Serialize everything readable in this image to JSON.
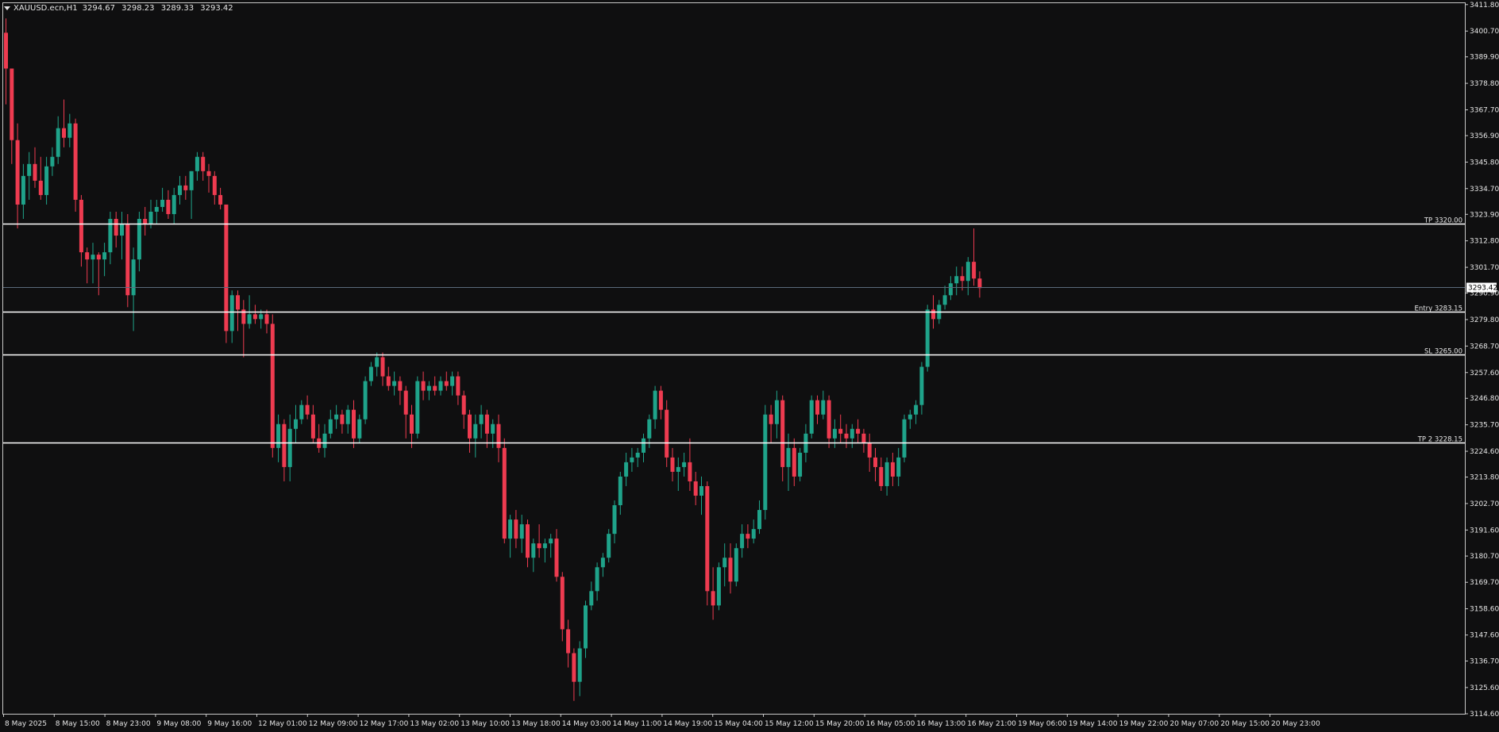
{
  "window": {
    "symbol_label": "XAUUSD.ecn,H1",
    "ohlc": [
      "3294.67",
      "3298.23",
      "3289.33",
      "3293.42"
    ]
  },
  "colors": {
    "background": "#0f0f10",
    "bull": "#1fa38a",
    "bear": "#ee3b50",
    "grid_line": "#ffffff",
    "text": "#e6e6e6",
    "price_line": "#5a6a7a"
  },
  "chart_data": {
    "type": "candlestick",
    "symbol": "XAUUSD.ecn",
    "timeframe": "H1",
    "ylim": [
      3114.6,
      3412.4
    ],
    "y_ticks": [
      "3411.80",
      "3400.70",
      "3389.90",
      "3378.80",
      "3367.70",
      "3356.90",
      "3345.80",
      "3334.70",
      "3323.90",
      "3312.80",
      "3301.70",
      "3290.90",
      "3279.80",
      "3268.70",
      "3257.60",
      "3246.80",
      "3235.70",
      "3224.60",
      "3213.80",
      "3202.70",
      "3191.60",
      "3180.70",
      "3169.70",
      "3158.60",
      "3147.60",
      "3136.70",
      "3125.60",
      "3114.60"
    ],
    "x_ticks": [
      "8 May 2025",
      "8 May 15:00",
      "8 May 23:00",
      "9 May 08:00",
      "9 May 16:00",
      "12 May 01:00",
      "12 May 09:00",
      "12 May 17:00",
      "13 May 02:00",
      "13 May 10:00",
      "13 May 18:00",
      "14 May 03:00",
      "14 May 11:00",
      "14 May 19:00",
      "15 May 04:00",
      "15 May 12:00",
      "15 May 20:00",
      "16 May 05:00",
      "16 May 13:00",
      "16 May 21:00",
      "19 May 06:00",
      "19 May 14:00",
      "19 May 22:00",
      "20 May 07:00",
      "20 May 15:00",
      "20 May 23:00"
    ],
    "current_price": "3293.42",
    "levels": [
      {
        "label": "TP 3320.00",
        "value": 3320.0
      },
      {
        "label": "Entry 3283.15",
        "value": 3283.15
      },
      {
        "label": "SL 3265.00",
        "value": 3265.0
      },
      {
        "label": "TP 2 3228.15",
        "value": 3228.15
      }
    ],
    "candles": [
      [
        3400,
        3406,
        3370,
        3385
      ],
      [
        3385,
        3380,
        3345,
        3355
      ],
      [
        3355,
        3362,
        3318,
        3328
      ],
      [
        3328,
        3345,
        3322,
        3340
      ],
      [
        3340,
        3350,
        3330,
        3345
      ],
      [
        3345,
        3352,
        3335,
        3338
      ],
      [
        3338,
        3348,
        3330,
        3332
      ],
      [
        3332,
        3348,
        3328,
        3344
      ],
      [
        3344,
        3352,
        3340,
        3348
      ],
      [
        3348,
        3365,
        3345,
        3360
      ],
      [
        3360,
        3372,
        3352,
        3356
      ],
      [
        3356,
        3366,
        3352,
        3362
      ],
      [
        3362,
        3364,
        3325,
        3330
      ],
      [
        3330,
        3332,
        3302,
        3308
      ],
      [
        3308,
        3310,
        3295,
        3305
      ],
      [
        3305,
        3312,
        3295,
        3307
      ],
      [
        3307,
        3308,
        3290,
        3305
      ],
      [
        3305,
        3312,
        3298,
        3308
      ],
      [
        3308,
        3325,
        3303,
        3322
      ],
      [
        3322,
        3325,
        3310,
        3315
      ],
      [
        3315,
        3325,
        3305,
        3320
      ],
      [
        3320,
        3324,
        3285,
        3290
      ],
      [
        3290,
        3310,
        3275,
        3305
      ],
      [
        3305,
        3325,
        3300,
        3322
      ],
      [
        3322,
        3327,
        3315,
        3320
      ],
      [
        3320,
        3330,
        3318,
        3325
      ],
      [
        3325,
        3330,
        3320,
        3327
      ],
      [
        3327,
        3335,
        3325,
        3330
      ],
      [
        3330,
        3334,
        3322,
        3324
      ],
      [
        3324,
        3335,
        3320,
        3332
      ],
      [
        3332,
        3340,
        3328,
        3336
      ],
      [
        3336,
        3340,
        3330,
        3334
      ],
      [
        3334,
        3342,
        3322,
        3342
      ],
      [
        3342,
        3350,
        3338,
        3348
      ],
      [
        3348,
        3350,
        3338,
        3342
      ],
      [
        3342,
        3345,
        3333,
        3340
      ],
      [
        3340,
        3342,
        3328,
        3332
      ],
      [
        3332,
        3335,
        3326,
        3328
      ],
      [
        3328,
        3318,
        3270,
        3275
      ],
      [
        3275,
        3292,
        3270,
        3290
      ],
      [
        3290,
        3292,
        3275,
        3284
      ],
      [
        3284,
        3288,
        3264,
        3278
      ],
      [
        3278,
        3290,
        3276,
        3282
      ],
      [
        3282,
        3286,
        3278,
        3280
      ],
      [
        3280,
        3284,
        3276,
        3282
      ],
      [
        3282,
        3284,
        3274,
        3278
      ],
      [
        3278,
        3282,
        3222,
        3226
      ],
      [
        3226,
        3240,
        3220,
        3236
      ],
      [
        3236,
        3238,
        3212,
        3218
      ],
      [
        3218,
        3240,
        3212,
        3234
      ],
      [
        3234,
        3244,
        3228,
        3238
      ],
      [
        3238,
        3246,
        3236,
        3244
      ],
      [
        3244,
        3248,
        3238,
        3240
      ],
      [
        3240,
        3244,
        3228,
        3230
      ],
      [
        3230,
        3236,
        3224,
        3226
      ],
      [
        3226,
        3236,
        3222,
        3232
      ],
      [
        3232,
        3242,
        3230,
        3238
      ],
      [
        3238,
        3244,
        3234,
        3240
      ],
      [
        3240,
        3242,
        3232,
        3236
      ],
      [
        3236,
        3244,
        3232,
        3242
      ],
      [
        3242,
        3246,
        3226,
        3230
      ],
      [
        3230,
        3240,
        3228,
        3238
      ],
      [
        3238,
        3256,
        3236,
        3254
      ],
      [
        3254,
        3262,
        3252,
        3260
      ],
      [
        3260,
        3266,
        3256,
        3264
      ],
      [
        3264,
        3266,
        3252,
        3256
      ],
      [
        3256,
        3260,
        3250,
        3252
      ],
      [
        3252,
        3258,
        3248,
        3254
      ],
      [
        3254,
        3256,
        3244,
        3250
      ],
      [
        3250,
        3252,
        3230,
        3240
      ],
      [
        3240,
        3244,
        3226,
        3232
      ],
      [
        3232,
        3256,
        3230,
        3254
      ],
      [
        3254,
        3258,
        3246,
        3250
      ],
      [
        3250,
        3254,
        3246,
        3252
      ],
      [
        3252,
        3256,
        3248,
        3250
      ],
      [
        3250,
        3256,
        3248,
        3254
      ],
      [
        3254,
        3258,
        3250,
        3252
      ],
      [
        3252,
        3258,
        3248,
        3256
      ],
      [
        3256,
        3258,
        3244,
        3248
      ],
      [
        3248,
        3250,
        3234,
        3240
      ],
      [
        3240,
        3242,
        3224,
        3230
      ],
      [
        3230,
        3240,
        3222,
        3236
      ],
      [
        3236,
        3244,
        3230,
        3240
      ],
      [
        3240,
        3242,
        3226,
        3232
      ],
      [
        3232,
        3238,
        3226,
        3236
      ],
      [
        3236,
        3240,
        3220,
        3226
      ],
      [
        3226,
        3230,
        3186,
        3188
      ],
      [
        3188,
        3198,
        3180,
        3196
      ],
      [
        3196,
        3200,
        3184,
        3188
      ],
      [
        3188,
        3198,
        3182,
        3194
      ],
      [
        3194,
        3196,
        3176,
        3180
      ],
      [
        3180,
        3188,
        3174,
        3186
      ],
      [
        3186,
        3194,
        3180,
        3184
      ],
      [
        3184,
        3188,
        3178,
        3186
      ],
      [
        3186,
        3190,
        3180,
        3188
      ],
      [
        3188,
        3192,
        3170,
        3172
      ],
      [
        3172,
        3174,
        3145,
        3150
      ],
      [
        3150,
        3154,
        3134,
        3140
      ],
      [
        3140,
        3142,
        3120,
        3128
      ],
      [
        3128,
        3145,
        3122,
        3142
      ],
      [
        3142,
        3162,
        3138,
        3160
      ],
      [
        3160,
        3170,
        3158,
        3166
      ],
      [
        3166,
        3178,
        3162,
        3176
      ],
      [
        3176,
        3182,
        3172,
        3180
      ],
      [
        3180,
        3192,
        3178,
        3190
      ],
      [
        3190,
        3204,
        3186,
        3202
      ],
      [
        3202,
        3216,
        3198,
        3214
      ],
      [
        3214,
        3224,
        3210,
        3220
      ],
      [
        3220,
        3226,
        3216,
        3222
      ],
      [
        3222,
        3226,
        3218,
        3224
      ],
      [
        3224,
        3232,
        3220,
        3230
      ],
      [
        3230,
        3240,
        3226,
        3238
      ],
      [
        3238,
        3252,
        3234,
        3250
      ],
      [
        3250,
        3252,
        3238,
        3242
      ],
      [
        3242,
        3246,
        3218,
        3222
      ],
      [
        3222,
        3226,
        3212,
        3216
      ],
      [
        3216,
        3222,
        3208,
        3218
      ],
      [
        3218,
        3224,
        3214,
        3220
      ],
      [
        3220,
        3230,
        3208,
        3212
      ],
      [
        3212,
        3216,
        3202,
        3206
      ],
      [
        3206,
        3214,
        3198,
        3210
      ],
      [
        3210,
        3212,
        3160,
        3166
      ],
      [
        3166,
        3176,
        3154,
        3160
      ],
      [
        3160,
        3178,
        3158,
        3176
      ],
      [
        3176,
        3186,
        3168,
        3180
      ],
      [
        3180,
        3186,
        3165,
        3170
      ],
      [
        3170,
        3186,
        3168,
        3184
      ],
      [
        3184,
        3194,
        3180,
        3190
      ],
      [
        3190,
        3194,
        3184,
        3188
      ],
      [
        3188,
        3196,
        3186,
        3192
      ],
      [
        3192,
        3204,
        3190,
        3200
      ],
      [
        3200,
        3244,
        3196,
        3240
      ],
      [
        3240,
        3244,
        3228,
        3236
      ],
      [
        3236,
        3250,
        3230,
        3246
      ],
      [
        3246,
        3248,
        3212,
        3218
      ],
      [
        3218,
        3232,
        3208,
        3226
      ],
      [
        3226,
        3230,
        3210,
        3214
      ],
      [
        3214,
        3226,
        3212,
        3224
      ],
      [
        3224,
        3236,
        3220,
        3232
      ],
      [
        3232,
        3248,
        3230,
        3246
      ],
      [
        3246,
        3248,
        3236,
        3240
      ],
      [
        3240,
        3250,
        3238,
        3246
      ],
      [
        3246,
        3248,
        3226,
        3230
      ],
      [
        3230,
        3238,
        3226,
        3234
      ],
      [
        3234,
        3240,
        3228,
        3232
      ],
      [
        3232,
        3236,
        3226,
        3230
      ],
      [
        3230,
        3236,
        3226,
        3234
      ],
      [
        3234,
        3238,
        3228,
        3232
      ],
      [
        3232,
        3234,
        3224,
        3228
      ],
      [
        3228,
        3232,
        3216,
        3222
      ],
      [
        3222,
        3226,
        3212,
        3218
      ],
      [
        3218,
        3222,
        3208,
        3210
      ],
      [
        3210,
        3222,
        3206,
        3220
      ],
      [
        3220,
        3224,
        3210,
        3214
      ],
      [
        3214,
        3226,
        3210,
        3222
      ],
      [
        3222,
        3240,
        3220,
        3238
      ],
      [
        3238,
        3242,
        3234,
        3240
      ],
      [
        3240,
        3246,
        3236,
        3244
      ],
      [
        3244,
        3262,
        3240,
        3260
      ],
      [
        3260,
        3286,
        3258,
        3284
      ],
      [
        3284,
        3290,
        3276,
        3280
      ],
      [
        3280,
        3288,
        3278,
        3286
      ],
      [
        3286,
        3294,
        3284,
        3290
      ],
      [
        3290,
        3298,
        3288,
        3295
      ],
      [
        3295,
        3302,
        3290,
        3298
      ],
      [
        3298,
        3302,
        3292,
        3296
      ],
      [
        3296,
        3306,
        3290,
        3304
      ],
      [
        3304,
        3318,
        3294,
        3297
      ],
      [
        3297,
        3300,
        3289,
        3293
      ]
    ]
  }
}
